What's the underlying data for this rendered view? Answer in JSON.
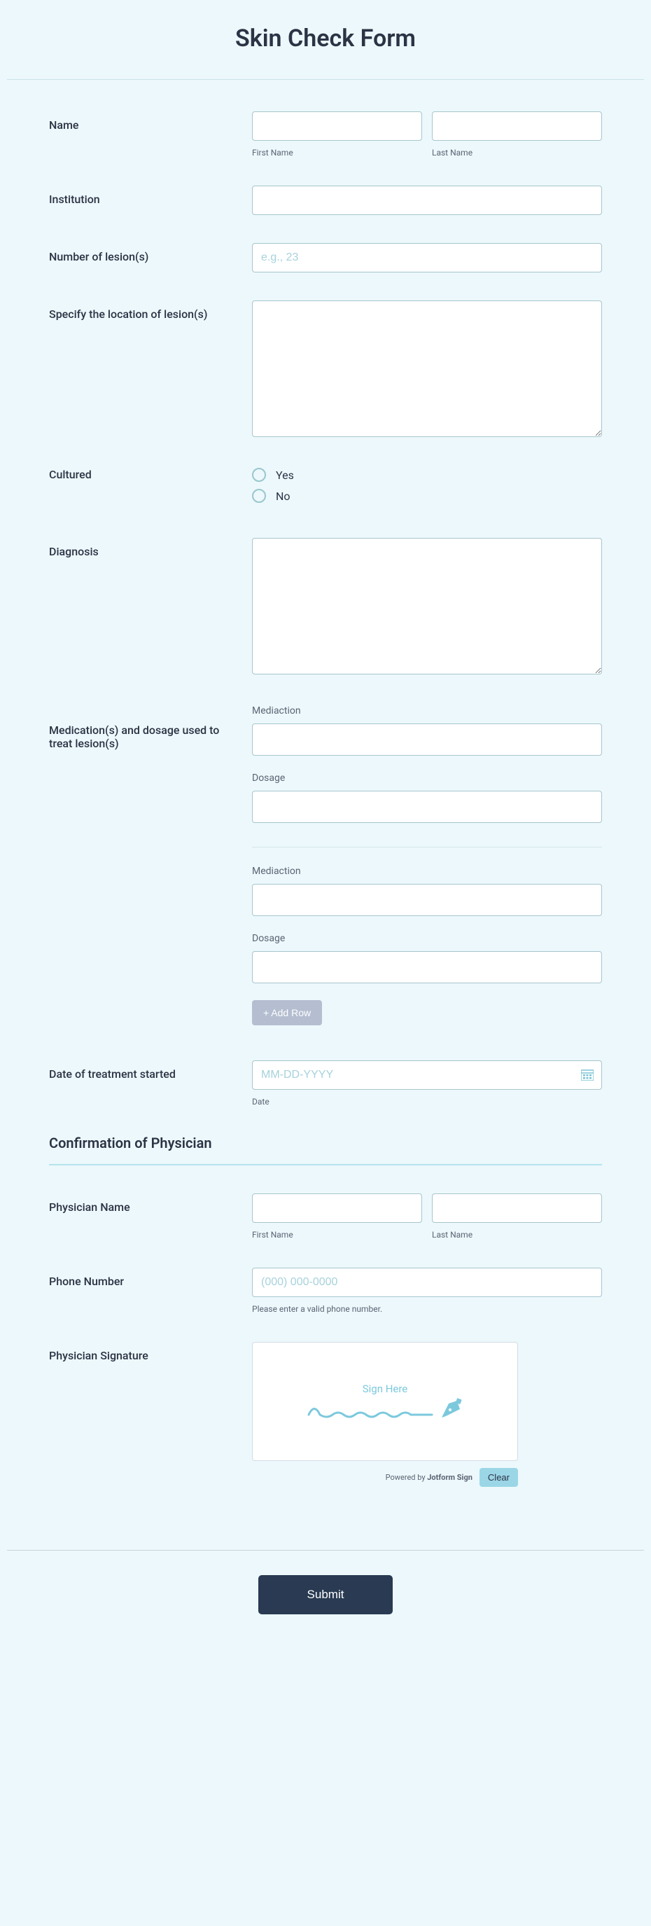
{
  "title": "Skin Check Form",
  "fields": {
    "name": {
      "label": "Name",
      "first_sub": "First Name",
      "last_sub": "Last Name"
    },
    "institution": {
      "label": "Institution"
    },
    "num_lesions": {
      "label": "Number of lesion(s)",
      "placeholder": "e.g., 23"
    },
    "location_lesions": {
      "label": "Specify the location of lesion(s)"
    },
    "cultured": {
      "label": "Cultured",
      "options": [
        "Yes",
        "No"
      ]
    },
    "diagnosis": {
      "label": "Diagnosis"
    },
    "medication": {
      "label": "Medication(s) and dosage used to treat lesion(s)",
      "med_label": "Mediaction",
      "dosage_label": "Dosage",
      "add_row": "+ Add Row"
    },
    "treatment_date": {
      "label": "Date of treatment started",
      "placeholder": "MM-DD-YYYY",
      "sub": "Date"
    }
  },
  "section_confirmation": "Confirmation of Physician",
  "physician": {
    "name": {
      "label": "Physician Name",
      "first_sub": "First Name",
      "last_sub": "Last Name"
    },
    "phone": {
      "label": "Phone Number",
      "placeholder": "(000) 000-0000",
      "help": "Please enter a valid phone number."
    },
    "signature": {
      "label": "Physician Signature",
      "sign_here": "Sign Here",
      "powered": "Powered by ",
      "brand": "Jotform Sign",
      "clear": "Clear"
    }
  },
  "submit": "Submit"
}
